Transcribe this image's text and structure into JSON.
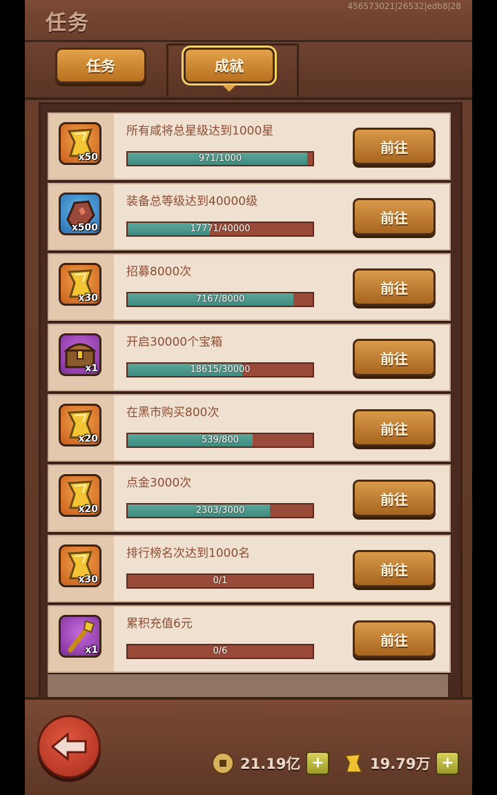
{
  "header": {
    "title": "任务",
    "build_info": "456573021|26532|edb8|28"
  },
  "tabs": [
    {
      "label": "任务",
      "active": false
    },
    {
      "label": "成就",
      "active": true
    }
  ],
  "goto_label": "前往",
  "tasks": [
    {
      "title": "所有咸将总星级达到1000星",
      "progress_text": "971/1000",
      "progress": 0.971,
      "reward_icon": "gold-ingot-icon",
      "reward_qty": "x50",
      "frame": "orange"
    },
    {
      "title": "装备总等级达到40000级",
      "progress_text": "17771/40000",
      "progress": 0.444,
      "reward_icon": "ore-stone-icon",
      "reward_qty": "x500",
      "frame": "blue"
    },
    {
      "title": "招募8000次",
      "progress_text": "7167/8000",
      "progress": 0.896,
      "reward_icon": "gold-ingot-icon",
      "reward_qty": "x30",
      "frame": "orange"
    },
    {
      "title": "开启30000个宝箱",
      "progress_text": "18615/30000",
      "progress": 0.621,
      "reward_icon": "treasure-chest-icon",
      "reward_qty": "x1",
      "frame": "purple"
    },
    {
      "title": "在黑市购买800次",
      "progress_text": "539/800",
      "progress": 0.674,
      "reward_icon": "gold-ingot-icon",
      "reward_qty": "x20",
      "frame": "orange"
    },
    {
      "title": "点金3000次",
      "progress_text": "2303/3000",
      "progress": 0.768,
      "reward_icon": "gold-ingot-icon",
      "reward_qty": "x20",
      "frame": "orange"
    },
    {
      "title": "排行榜名次达到1000名",
      "progress_text": "0/1",
      "progress": 0,
      "reward_icon": "gold-ingot-icon",
      "reward_qty": "x30",
      "frame": "orange"
    },
    {
      "title": "累积充值6元",
      "progress_text": "0/6",
      "progress": 0,
      "reward_icon": "golden-staff-icon",
      "reward_qty": "x1",
      "frame": "purple"
    }
  ],
  "currency": {
    "coins": {
      "value": "21.19亿",
      "icon": "copper-coin-icon"
    },
    "ingots": {
      "value": "19.79万",
      "icon": "gold-ingot-icon"
    }
  },
  "colors": {
    "progress_fill": "#3f8a7f",
    "progress_empty": "#9a4a38",
    "button": "#c98a3a"
  }
}
